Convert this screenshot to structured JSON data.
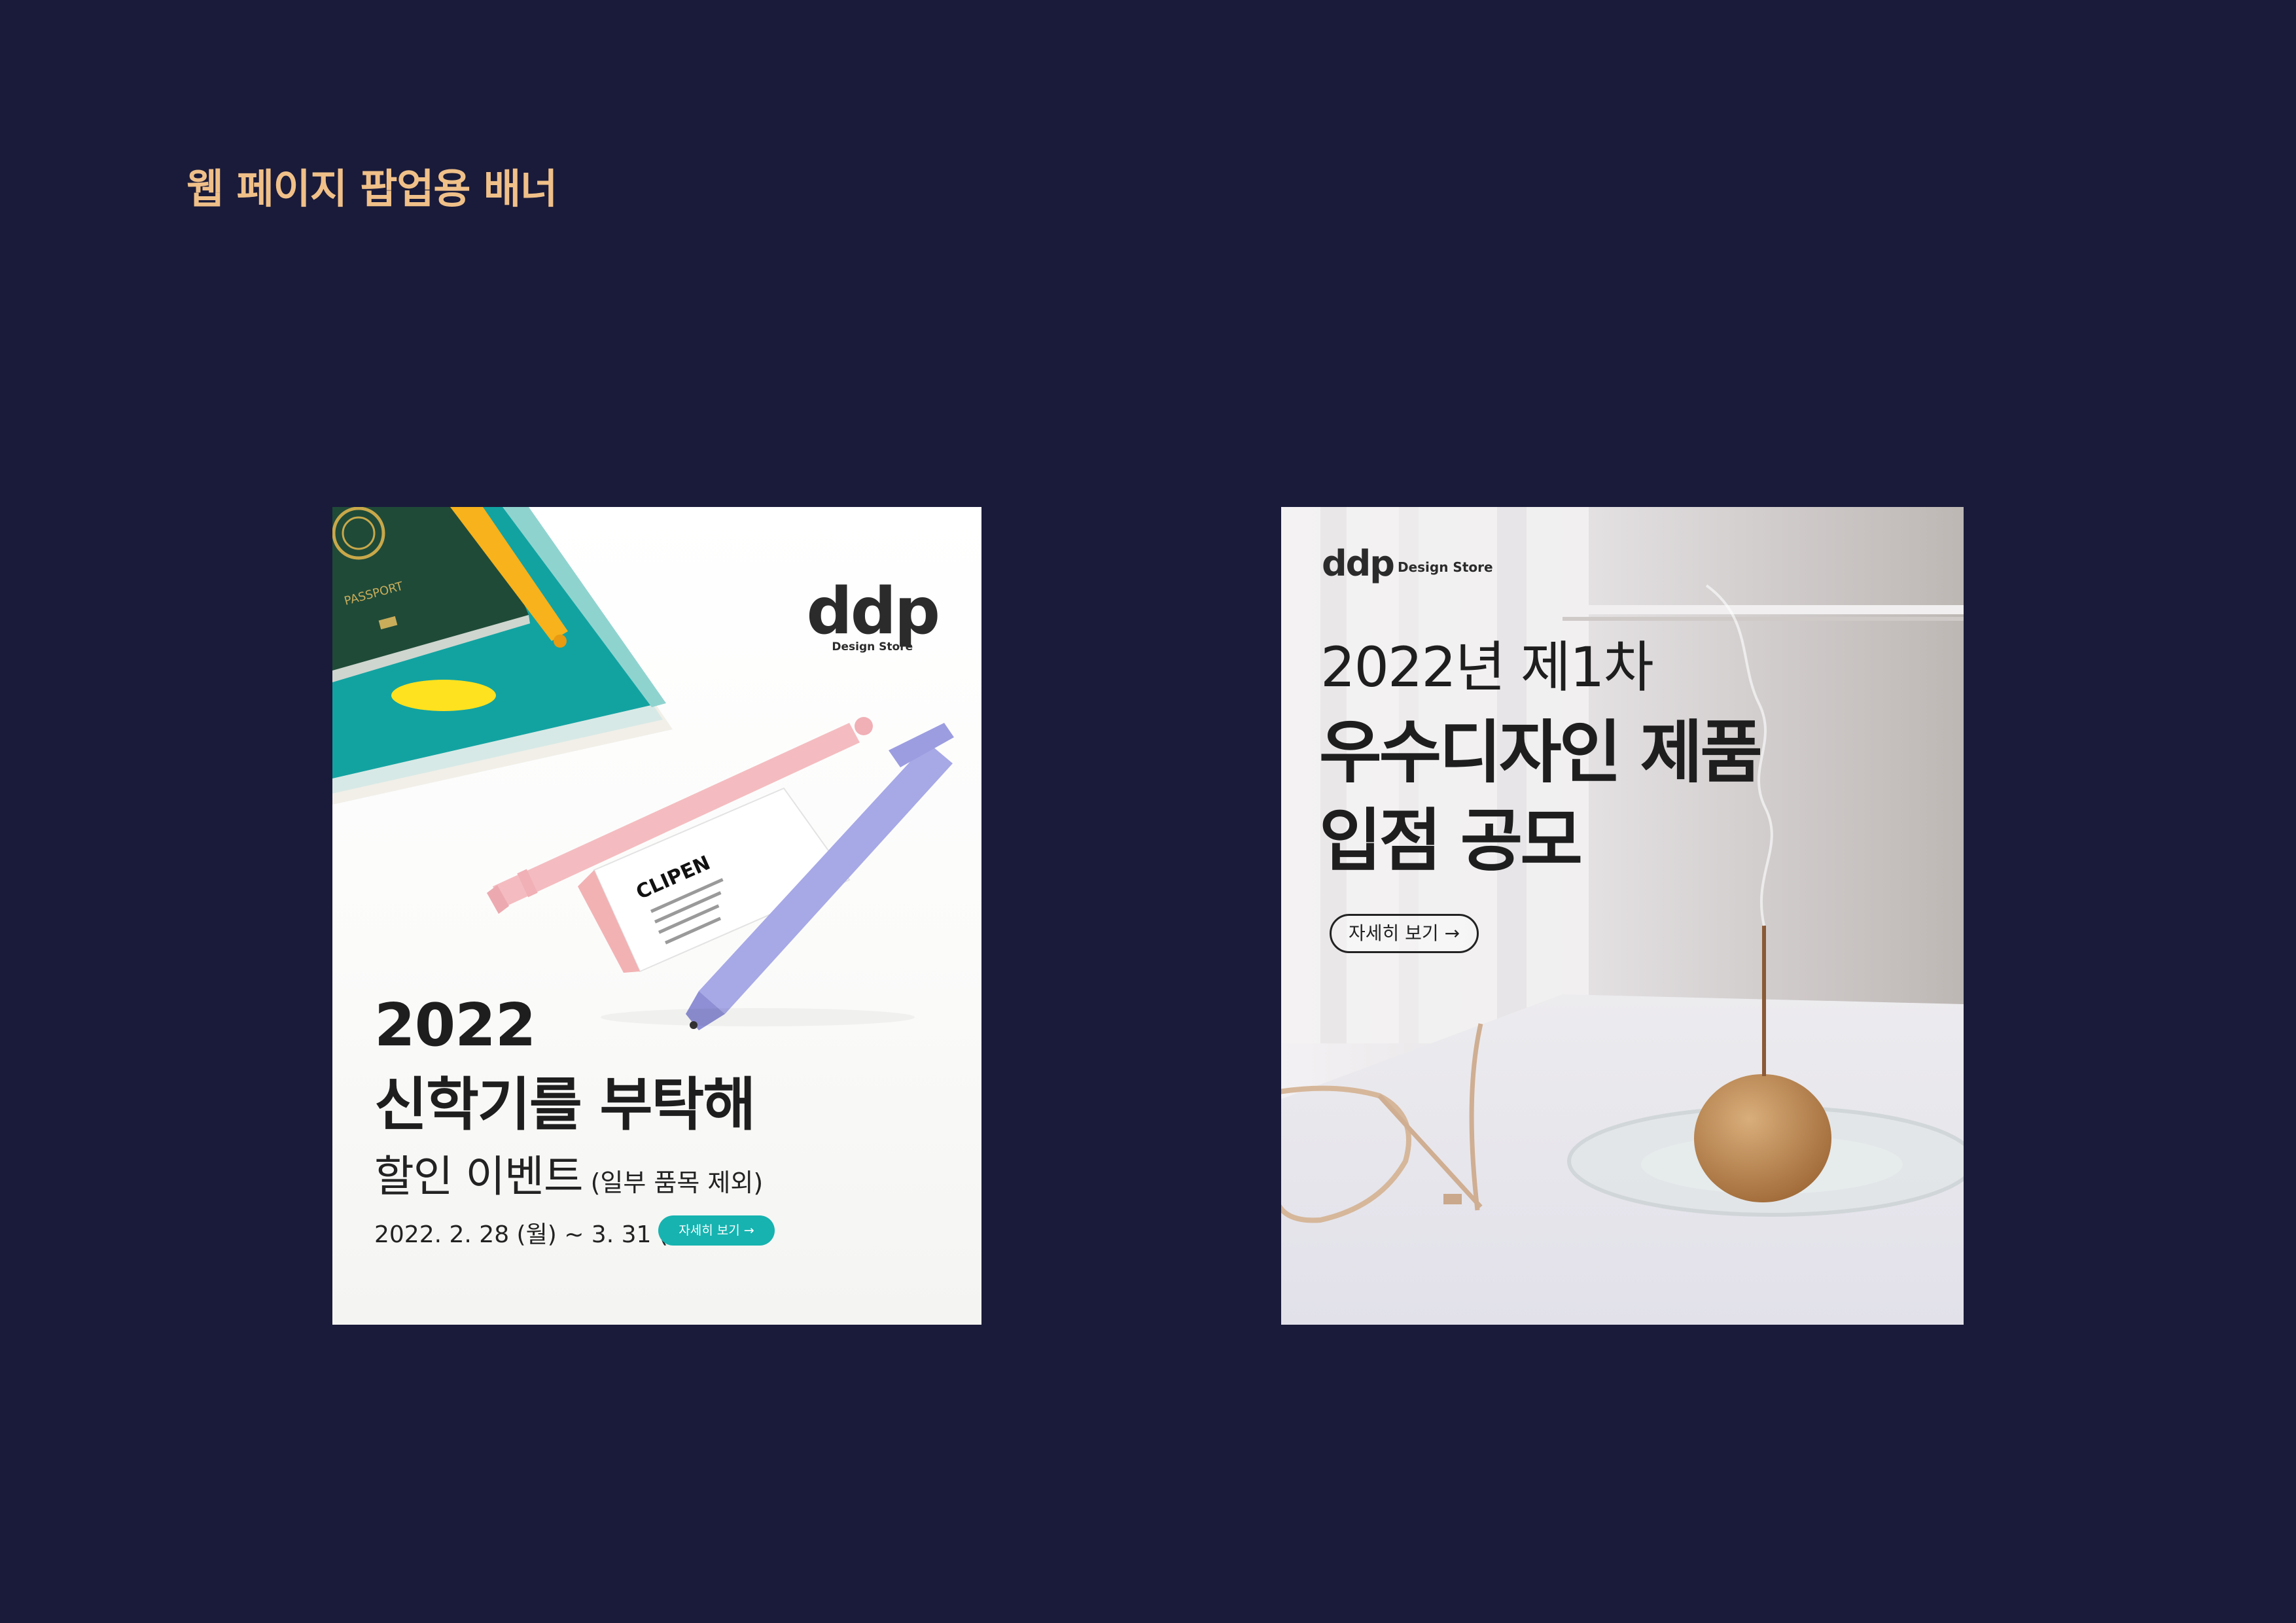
{
  "page": {
    "title": "웹 페이지 팝업용 배너"
  },
  "banner1": {
    "logo_mark": "ddp",
    "logo_sub": "Design Store",
    "year": "2022",
    "headline": "신학기를 부탁해",
    "event": "할인 이벤트",
    "event_note": "(일부 품목 제외)",
    "date": "2022. 2. 28 (월) ~ 3. 31 (목)",
    "button_label": "자세히 보기 →",
    "accent_color": "#16b3b0"
  },
  "banner2": {
    "logo_mark": "ddp",
    "logo_sub": "Design Store",
    "line1": "2022년 제1차",
    "line2": "우수디자인 제품",
    "line3": "입점 공모",
    "button_label": "자세히 보기 →"
  }
}
